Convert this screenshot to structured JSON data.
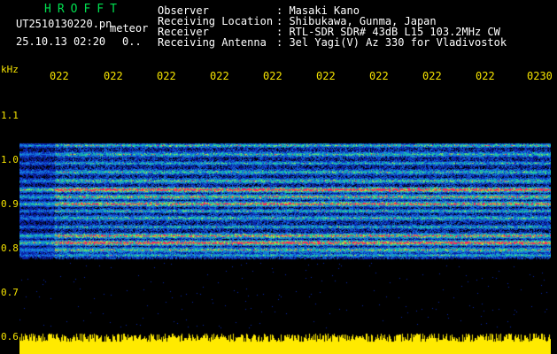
{
  "header": {
    "logo": "HROFFT",
    "filename": "UT2510130220.pn",
    "mode": "meteor",
    "datetime": "25.10.13 02:20",
    "extra": "0.."
  },
  "station": {
    "rows": [
      {
        "key": "Observer",
        "value": ": Masaki Kano"
      },
      {
        "key": "Receiving Location",
        "value": ": Shibukawa, Gunma, Japan"
      },
      {
        "key": "Receiver",
        "value": ": RTL-SDR SDR# 43dB L15 103.2MHz CW"
      },
      {
        "key": "Receiving Antenna",
        "value": ": 3el Yagi(V) Az 330 for Vladivostok"
      }
    ]
  },
  "axes": {
    "freq_unit": "kHz",
    "freq_ticks": [
      "1.1",
      "1.0",
      "0.9",
      "0.8",
      "0.7",
      "0.6"
    ],
    "time_ticks": [
      "022",
      "022",
      "022",
      "022",
      "022",
      "022",
      "022",
      "022",
      "022",
      "0230"
    ]
  },
  "colors": {
    "background": "#000000",
    "text": "#ffffff",
    "axis": "#f5e300",
    "logo": "#00e050",
    "signal_strong": "#ff2050",
    "signal_mid": "#20e0a0",
    "noise": "#1030c0",
    "baseline": "#ffea00"
  }
}
